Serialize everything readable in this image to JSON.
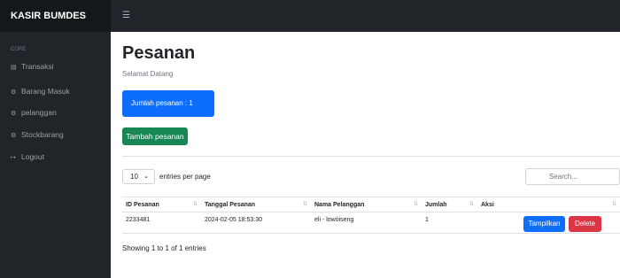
{
  "brand": "KASIR BUMDES",
  "hamburger_icon": "☰",
  "sidebar": {
    "heading": "core",
    "items": [
      {
        "icon": "▤",
        "icon_name": "table-icon",
        "label": "Transaksi"
      },
      {
        "icon": "⚙",
        "icon_name": "gear-icon",
        "label": "Barang Masuk"
      },
      {
        "icon": "⚙",
        "icon_name": "gear-icon",
        "label": "pelanggan"
      },
      {
        "icon": "⚙",
        "icon_name": "gear-icon",
        "label": "Stockbarang"
      },
      {
        "icon": "↦",
        "icon_name": "logout-icon",
        "label": "Logout"
      }
    ]
  },
  "page": {
    "title": "Pesanan",
    "subtitle": "Selamat Datang",
    "card_text": "Jumlah pesanan : 1",
    "add_button": "Tambah pesanan"
  },
  "table_controls": {
    "entries_value": "10",
    "entries_label": "entries per page",
    "search_placeholder": "Search..."
  },
  "table": {
    "headers": [
      "ID Pesanan",
      "Tanggal Pesanan",
      "Nama Pelanggan",
      "Jumlah",
      "Aksi"
    ],
    "rows": [
      {
        "id": "2233481",
        "date": "2024-02-05 18:53:30",
        "name": "eli - lowóiseng",
        "qty": "1"
      }
    ],
    "show_button": "Tampilkan",
    "delete_button": "Delete"
  },
  "footer": {
    "showing": "Showing 1 to 1 of 1 entries"
  },
  "colors": {
    "sidebar_bg": "#212529",
    "primary": "#0d6efd",
    "success": "#198754",
    "danger": "#dc3545"
  }
}
